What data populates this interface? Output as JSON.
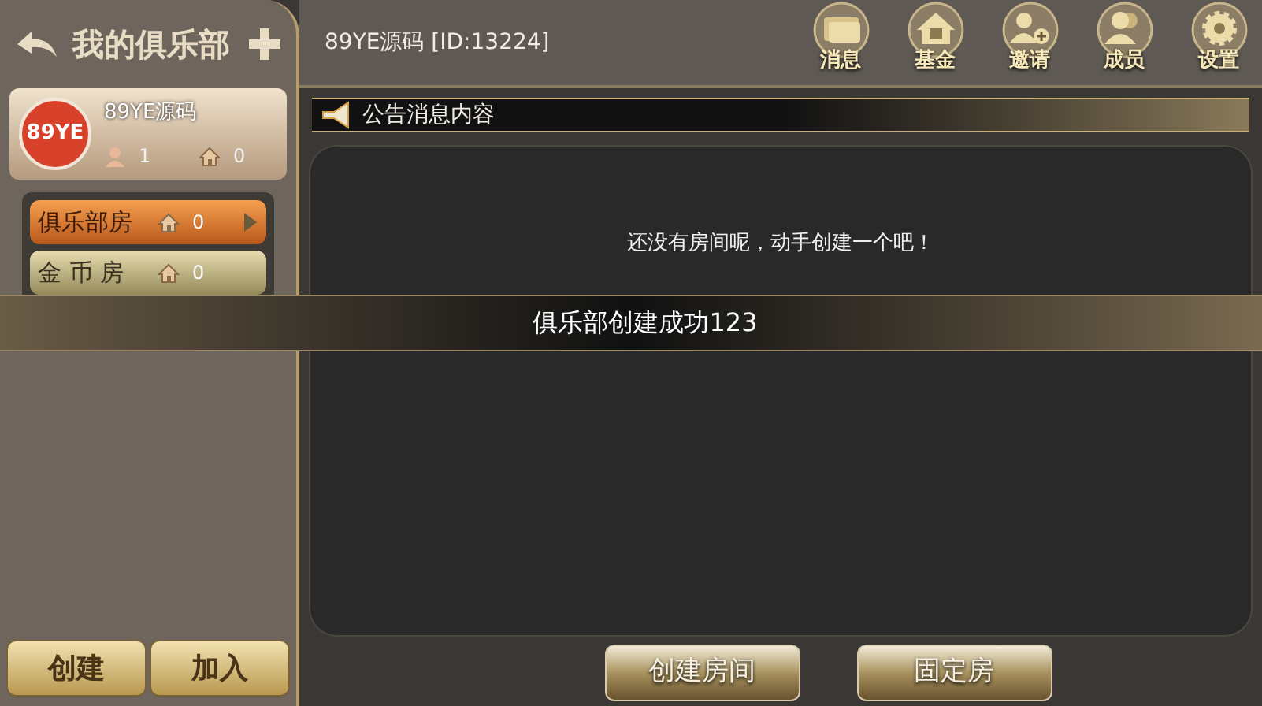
{
  "sidebar": {
    "title": "我的俱乐部",
    "club": {
      "logo": "89YE",
      "name": "89YE源码",
      "members": "1",
      "rooms": "0"
    },
    "room_types": [
      {
        "label": "俱乐部房",
        "count": "0",
        "selected": true
      },
      {
        "label": "金 币 房",
        "count": "0",
        "selected": false
      }
    ],
    "buttons": [
      "创建",
      "加入"
    ]
  },
  "header": {
    "title": "89YE源码 [ID:13224]",
    "actions": [
      "消息",
      "基金",
      "邀请",
      "成员",
      "设置"
    ]
  },
  "notice": {
    "title": "公告消息内容"
  },
  "empty_message": "还没有房间呢，动手创建一个吧！",
  "buttons": [
    "创建房间",
    "固定房"
  ],
  "toast": "俱乐部创建成功123"
}
